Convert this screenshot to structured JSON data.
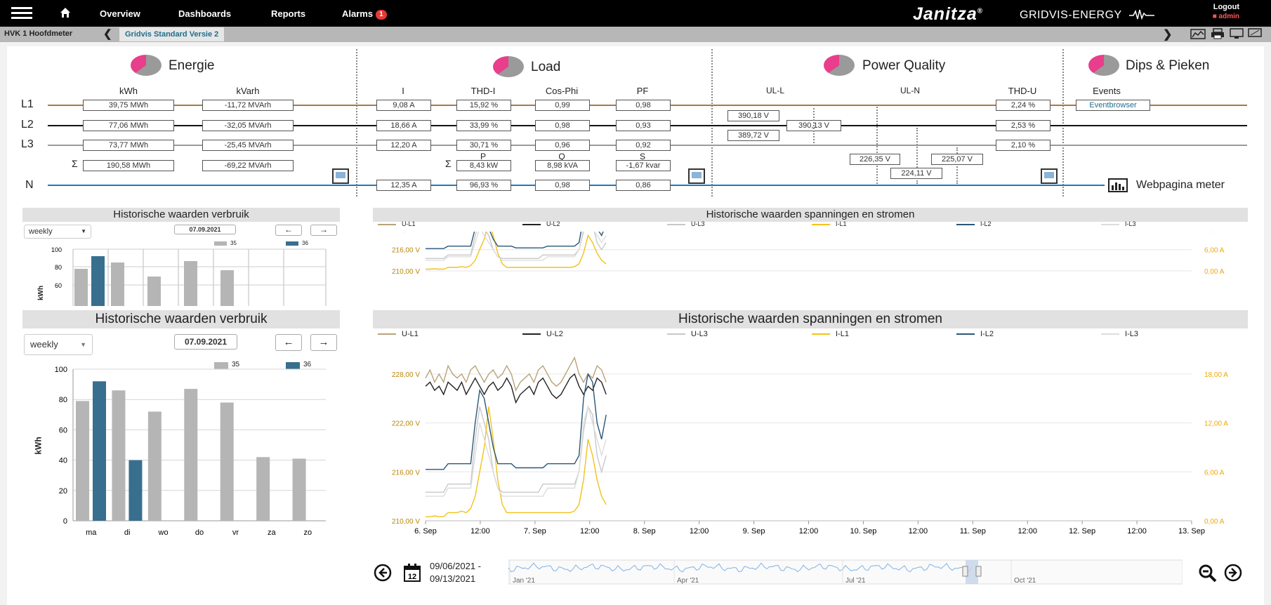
{
  "topbar": {
    "nav": [
      {
        "label": "Overview"
      },
      {
        "label": "Dashboards"
      },
      {
        "label": "Reports"
      },
      {
        "label": "Alarms"
      }
    ],
    "alarm_count": "1",
    "brand": "Janitza",
    "brand_mark": "®",
    "product": "GRIDVIS-ENERGY",
    "logout": "Logout",
    "user": "admin"
  },
  "breadcrumb": {
    "device": "HVK 1 Hoofdmeter",
    "dashboard": "Gridvis Standard Versie 2"
  },
  "sections": {
    "energie": "Energie",
    "load": "Load",
    "power_quality": "Power Quality",
    "dips": "Dips & Pieken"
  },
  "rows": [
    "L1",
    "L2",
    "L3",
    "N"
  ],
  "sigma": "Σ",
  "energie": {
    "col_kwh": "kWh",
    "col_kvarh": "kVarh",
    "kwh": [
      "39,75 MWh",
      "77,06 MWh",
      "73,77 MWh"
    ],
    "kvarh": [
      "-11,72 MVArh",
      "-32,05 MVArh",
      "-25,45 MVArh"
    ],
    "sum_kwh": "190,58 MWh",
    "sum_kvarh": "-69,22 MVArh"
  },
  "load": {
    "col_i": "I",
    "col_thd": "THD-I",
    "col_cos": "Cos-Phi",
    "col_pf": "PF",
    "i": [
      "9,08 A",
      "18,66 A",
      "12,20 A",
      "12,35 A"
    ],
    "thd": [
      "15,92 %",
      "33,99 %",
      "30,71 %",
      "96,93 %"
    ],
    "cos": [
      "0,99",
      "0,98",
      "0,96",
      "0,98"
    ],
    "pf": [
      "0,98",
      "0,93",
      "0,92",
      "0,86"
    ],
    "lbl_p": "P",
    "lbl_q": "Q",
    "lbl_s": "S",
    "p": "8,43 kW",
    "q": "8,98 kVA",
    "s": "-1,67 kvar"
  },
  "pq": {
    "col_ull": "UL-L",
    "col_uln": "UL-N",
    "col_thdu": "THD-U",
    "ull": [
      "390,18 V",
      "390,13 V",
      "389,72 V"
    ],
    "uln": [
      "226,35 V",
      "224,11 V",
      "225,07 V"
    ],
    "thdu": [
      "2,24 %",
      "2,53 %",
      "2,10 %"
    ]
  },
  "dips": {
    "col_events": "Events",
    "eventbrowser": "Eventbrowser",
    "webpage": "Webpagina meter"
  },
  "consumption_small": {
    "title": "Historische waarden verbruik",
    "period": "weekly",
    "date": "07.09.2021",
    "legend": [
      "35",
      "36"
    ],
    "ylabel": "kWh"
  },
  "consumption": {
    "title": "Historische waarden verbruik",
    "period": "weekly",
    "date": "07.09.2021",
    "prev": "←",
    "next": "→"
  },
  "voltages_small": {
    "title": "Historische waarden spanningen en stromen"
  },
  "voltages": {
    "title": "Historische waarden spanningen en stromen",
    "legend": [
      "U-L1",
      "U-L2",
      "U-L3",
      "I-L1",
      "I-L2",
      "I-L3"
    ],
    "range_from": "09/06/2021 -",
    "range_to": "09/13/2021",
    "nav_labels": [
      "Jan '21",
      "Apr '21",
      "Jul '21",
      "Oct '21"
    ]
  },
  "colors": {
    "l1": "#a9784a",
    "l2": "#111111",
    "l3": "#9a9a9a",
    "n": "#1f77c4",
    "bar35": "#b5b5b5",
    "bar36": "#386f8e",
    "ul1": "#b8a37a",
    "ul2": "#222222",
    "ul3": "#c8c8c8",
    "il1": "#f2c21b",
    "il2": "#2b5777",
    "il3": "#dddddd"
  },
  "chart_data": [
    {
      "type": "bar",
      "title": "Historische waarden verbruik",
      "ylabel": "kWh",
      "categories": [
        "ma",
        "di",
        "wo",
        "do",
        "vr",
        "za",
        "zo"
      ],
      "series": [
        {
          "name": "35",
          "values": [
            79,
            86,
            72,
            87,
            78,
            42,
            41
          ]
        },
        {
          "name": "36",
          "values": [
            92,
            40,
            null,
            null,
            null,
            null,
            null
          ]
        }
      ],
      "ylim": [
        0,
        100
      ],
      "yticks": [
        0,
        20,
        40,
        60,
        80,
        100
      ],
      "legend": "top-right",
      "grid": true
    },
    {
      "type": "line",
      "title": "Historische waarden spanningen en stromen",
      "x_range": [
        "6. Sep",
        "13. Sep"
      ],
      "xticks": [
        "6. Sep",
        "12:00",
        "7. Sep",
        "12:00",
        "8. Sep",
        "12:00",
        "9. Sep",
        "12:00",
        "10. Sep",
        "12:00",
        "11. Sep",
        "12:00",
        "12. Sep",
        "12:00",
        "13. Sep"
      ],
      "y_left_ticks": [
        "210,00 V",
        "216,00 V",
        "222,00 V",
        "228,00 V"
      ],
      "y_right_ticks": [
        "0,00 A",
        "6,00 A",
        "12,00 A",
        "18,00 A"
      ],
      "ylim_left": [
        210,
        231
      ],
      "ylim_right": [
        0,
        21
      ],
      "x_data_days": [
        0,
        1.65
      ],
      "series": [
        {
          "name": "U-L1",
          "axis": "left",
          "values": [
            227.5,
            228.5,
            227,
            228,
            227,
            229,
            228,
            227.5,
            228,
            227,
            228.5,
            229,
            228,
            227,
            228,
            228.5,
            227.5,
            228,
            229,
            228,
            226,
            227,
            227.5,
            228,
            227,
            228.5,
            229,
            228,
            227,
            226.5,
            227,
            228,
            229,
            230,
            228,
            227,
            228,
            227.5,
            229,
            228.5,
            227
          ]
        },
        {
          "name": "U-L2",
          "axis": "left",
          "values": [
            226.5,
            227,
            226,
            226.5,
            225.5,
            227,
            226.5,
            226,
            227,
            225.5,
            226.5,
            227.5,
            226.5,
            225.5,
            226.5,
            227,
            226,
            226.5,
            227.5,
            226.5,
            224.5,
            225.5,
            226,
            226.5,
            225.5,
            227,
            227.5,
            226.5,
            225.5,
            225,
            225.5,
            226.5,
            227.5,
            228,
            226.5,
            225.5,
            226.5,
            226,
            227.5,
            227,
            225.5
          ]
        },
        {
          "name": "U-L3",
          "axis": "left",
          "values": [
            213.5,
            213.5,
            213.5,
            213.5,
            213.5,
            214.5,
            214.5,
            214.5,
            214.5,
            214.5,
            214.5,
            220,
            224,
            222,
            220,
            216,
            214,
            213.5,
            213.5,
            213.5,
            213.5,
            213.5,
            213.5,
            213.5,
            213.5,
            213.5,
            214.5,
            214.5,
            214.5,
            214.5,
            214.5,
            214.5,
            214.5,
            214.5,
            216,
            221,
            224,
            223,
            218,
            216,
            218
          ]
        },
        {
          "name": "I-L1",
          "axis": "right",
          "values": [
            0.5,
            0.5,
            0.6,
            0.5,
            0.5,
            1,
            1,
            1,
            1.2,
            1,
            1.5,
            3,
            6,
            9,
            14,
            10,
            5,
            2,
            1,
            1,
            1,
            1,
            1,
            1,
            1,
            1,
            1,
            1,
            1,
            1,
            1,
            1,
            1,
            1.2,
            2,
            5,
            10,
            8,
            5,
            3,
            2
          ]
        },
        {
          "name": "I-L2",
          "axis": "right",
          "values": [
            6.3,
            6.3,
            6.3,
            6.3,
            6.3,
            7,
            7,
            7,
            7,
            7,
            7,
            12,
            16,
            15,
            12,
            9,
            7,
            7,
            7,
            7,
            6.5,
            6.5,
            6.5,
            6.5,
            6.5,
            6.5,
            6.5,
            7,
            7,
            7,
            7,
            7,
            7,
            7,
            8,
            15,
            18,
            17,
            12,
            10,
            13
          ]
        },
        {
          "name": "I-L3",
          "axis": "right",
          "values": [
            3,
            3,
            3,
            3,
            3,
            4,
            4,
            4,
            4,
            4,
            4,
            8,
            12,
            10,
            8,
            6,
            4,
            3,
            3,
            3,
            3,
            3,
            3,
            3,
            3,
            3,
            3,
            4,
            4,
            4,
            4,
            4,
            4,
            4,
            6,
            12,
            14,
            12,
            10,
            8,
            10
          ]
        }
      ],
      "legend": "top",
      "grid": true
    }
  ]
}
